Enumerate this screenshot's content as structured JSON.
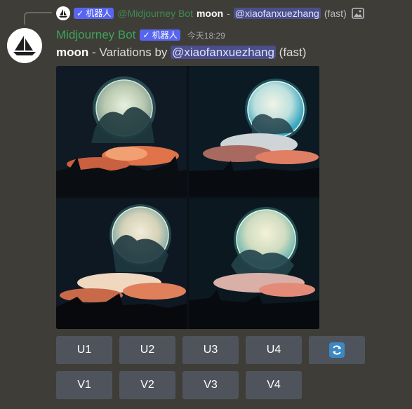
{
  "reply": {
    "badge": "✓ 机器人",
    "author_mention": "@Midjourney Bot",
    "prompt": "moon",
    "dash": "-",
    "mention": "@xiaofanxuezhang",
    "speed": "(fast)"
  },
  "message": {
    "username": "Midjourney Bot",
    "badge": "✓ 机器人",
    "timestamp": "今天18:29",
    "prompt": "moon",
    "text": " - Variations by ",
    "mention": "@xiaofanxuezhang",
    "speed": " (fast)"
  },
  "buttons": {
    "row1": [
      "U1",
      "U2",
      "U3",
      "U4"
    ],
    "row2": [
      "V1",
      "V2",
      "V3",
      "V4"
    ]
  },
  "colors": {
    "background": "#3f3d37",
    "username": "#3ba55d",
    "badge": "#5865f2",
    "button": "#4f545c",
    "refresh": "#3b88c3"
  }
}
